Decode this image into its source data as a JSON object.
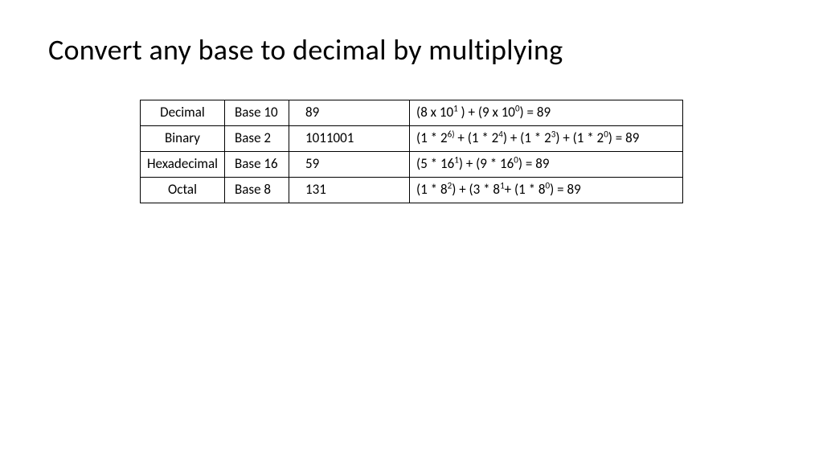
{
  "title": "Convert any base to decimal by multiplying",
  "rows": [
    {
      "name": "Decimal",
      "base": "Base 10",
      "value": "89",
      "expr": "(8 x 10<sup>1</sup> ) + (9 x 10<sup>0</sup>)  =    89"
    },
    {
      "name": "Binary",
      "base": "Base 2",
      "value": "1011001",
      "expr": "(1 * 2<sup>6)</sup> + (1 * 2<sup>4</sup>) + (1 * 2<sup>3</sup>) + (1 * 2<sup>0</sup>) = 89"
    },
    {
      "name": "Hexadecimal",
      "base": "Base 16",
      "value": "59",
      "expr": "(5 * 16<sup>1</sup>)  + (9 * 16<sup>0</sup>) = 89"
    },
    {
      "name": "Octal",
      "base": "Base 8",
      "value": "131",
      "expr": "(1 * 8<sup>2</sup>) + (3 * 8<sup>1</sup>+ (1 * 8<sup>0</sup>) = 89"
    }
  ]
}
